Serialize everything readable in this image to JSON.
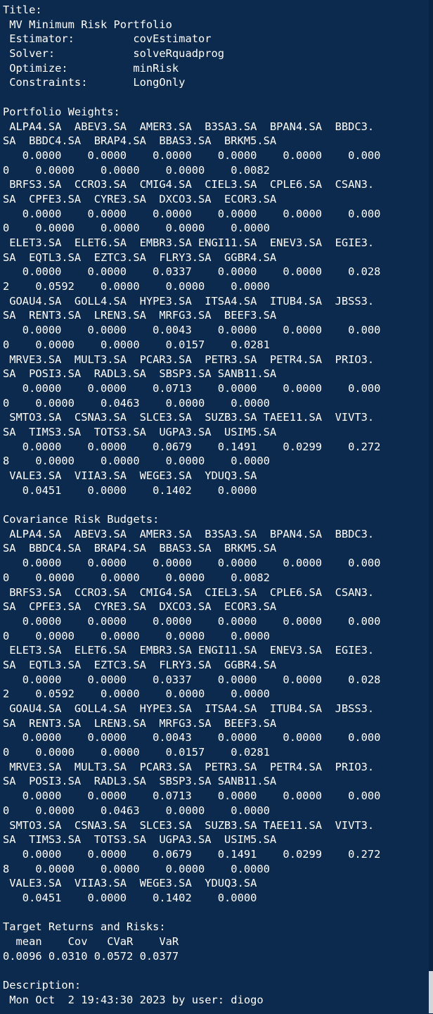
{
  "console": {
    "lines": [
      "Title:",
      " MV Minimum Risk Portfolio",
      " Estimator:         covEstimator",
      " Solver:            solveRquadprog",
      " Optimize:          minRisk",
      " Constraints:       LongOnly",
      "",
      "Portfolio Weights:",
      " ALPA4.SA  ABEV3.SA  AMER3.SA  B3SA3.SA  BPAN4.SA  BBDC3.",
      "SA  BBDC4.SA  BRAP4.SA  BBAS3.SA  BRKM5.SA",
      "   0.0000    0.0000    0.0000    0.0000    0.0000    0.000",
      "0    0.0000    0.0000    0.0000    0.0082",
      " BRFS3.SA  CCRO3.SA  CMIG4.SA  CIEL3.SA  CPLE6.SA  CSAN3.",
      "SA  CPFE3.SA  CYRE3.SA  DXCO3.SA  ECOR3.SA",
      "   0.0000    0.0000    0.0000    0.0000    0.0000    0.000",
      "0    0.0000    0.0000    0.0000    0.0000",
      " ELET3.SA  ELET6.SA  EMBR3.SA ENGI11.SA  ENEV3.SA  EGIE3.",
      "SA  EQTL3.SA  EZTC3.SA  FLRY3.SA  GGBR4.SA",
      "   0.0000    0.0000    0.0337    0.0000    0.0000    0.028",
      "2    0.0592    0.0000    0.0000    0.0000",
      " GOAU4.SA  GOLL4.SA  HYPE3.SA  ITSA4.SA  ITUB4.SA  JBSS3.",
      "SA  RENT3.SA  LREN3.SA  MRFG3.SA  BEEF3.SA",
      "   0.0000    0.0000    0.0043    0.0000    0.0000    0.000",
      "0    0.0000    0.0000    0.0157    0.0281",
      " MRVE3.SA  MULT3.SA  PCAR3.SA  PETR3.SA  PETR4.SA  PRIO3.",
      "SA  POSI3.SA  RADL3.SA  SBSP3.SA SANB11.SA",
      "   0.0000    0.0000    0.0713    0.0000    0.0000    0.000",
      "0    0.0000    0.0463    0.0000    0.0000",
      " SMTO3.SA  CSNA3.SA  SLCE3.SA  SUZB3.SA TAEE11.SA  VIVT3.",
      "SA  TIMS3.SA  TOTS3.SA  UGPA3.SA  USIM5.SA",
      "   0.0000    0.0000    0.0679    0.1491    0.0299    0.272",
      "8    0.0000    0.0000    0.0000    0.0000",
      " VALE3.SA  VIIA3.SA  WEGE3.SA  YDUQ3.SA",
      "   0.0451    0.0000    0.1402    0.0000",
      "",
      "Covariance Risk Budgets:",
      " ALPA4.SA  ABEV3.SA  AMER3.SA  B3SA3.SA  BPAN4.SA  BBDC3.",
      "SA  BBDC4.SA  BRAP4.SA  BBAS3.SA  BRKM5.SA",
      "   0.0000    0.0000    0.0000    0.0000    0.0000    0.000",
      "0    0.0000    0.0000    0.0000    0.0082",
      " BRFS3.SA  CCRO3.SA  CMIG4.SA  CIEL3.SA  CPLE6.SA  CSAN3.",
      "SA  CPFE3.SA  CYRE3.SA  DXCO3.SA  ECOR3.SA",
      "   0.0000    0.0000    0.0000    0.0000    0.0000    0.000",
      "0    0.0000    0.0000    0.0000    0.0000",
      " ELET3.SA  ELET6.SA  EMBR3.SA ENGI11.SA  ENEV3.SA  EGIE3.",
      "SA  EQTL3.SA  EZTC3.SA  FLRY3.SA  GGBR4.SA",
      "   0.0000    0.0000    0.0337    0.0000    0.0000    0.028",
      "2    0.0592    0.0000    0.0000    0.0000",
      " GOAU4.SA  GOLL4.SA  HYPE3.SA  ITSA4.SA  ITUB4.SA  JBSS3.",
      "SA  RENT3.SA  LREN3.SA  MRFG3.SA  BEEF3.SA",
      "   0.0000    0.0000    0.0043    0.0000    0.0000    0.000",
      "0    0.0000    0.0000    0.0157    0.0281",
      " MRVE3.SA  MULT3.SA  PCAR3.SA  PETR3.SA  PETR4.SA  PRIO3.",
      "SA  POSI3.SA  RADL3.SA  SBSP3.SA SANB11.SA",
      "   0.0000    0.0000    0.0713    0.0000    0.0000    0.000",
      "0    0.0000    0.0463    0.0000    0.0000",
      " SMTO3.SA  CSNA3.SA  SLCE3.SA  SUZB3.SA TAEE11.SA  VIVT3.",
      "SA  TIMS3.SA  TOTS3.SA  UGPA3.SA  USIM5.SA",
      "   0.0000    0.0000    0.0679    0.1491    0.0299    0.272",
      "8    0.0000    0.0000    0.0000    0.0000",
      " VALE3.SA  VIIA3.SA  WEGE3.SA  YDUQ3.SA",
      "   0.0451    0.0000    0.1402    0.0000",
      "",
      "Target Returns and Risks:",
      "  mean    Cov   CVaR    VaR",
      "0.0096 0.0310 0.0572 0.0377",
      "",
      "Description:",
      " Mon Oct  2 19:43:30 2023 by user: diogo"
    ]
  },
  "colors": {
    "background": "#0c2a4d",
    "text": "#ffffff",
    "scrollbar_thumb": "#cfd6de"
  }
}
